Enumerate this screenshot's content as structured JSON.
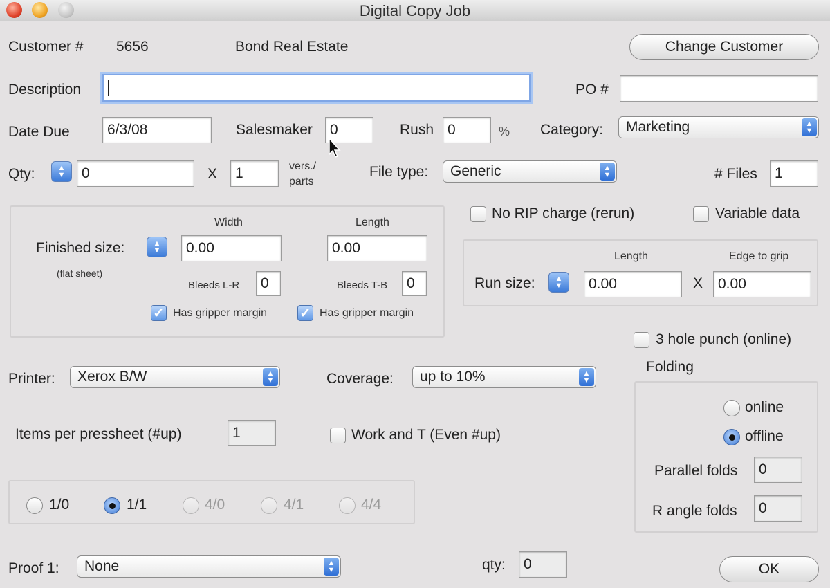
{
  "window": {
    "title": "Digital Copy Job"
  },
  "customer": {
    "label": "Customer #",
    "number": "5656",
    "name": "Bond Real Estate",
    "change_button": "Change Customer"
  },
  "description": {
    "label": "Description",
    "value": ""
  },
  "po": {
    "label": "PO #",
    "value": ""
  },
  "date_due": {
    "label": "Date Due",
    "value": "6/3/08"
  },
  "salesmaker": {
    "label": "Salesmaker",
    "value": "0"
  },
  "rush": {
    "label": "Rush",
    "value": "0",
    "unit": "%"
  },
  "category": {
    "label": "Category:",
    "value": "Marketing"
  },
  "qty": {
    "label": "Qty:",
    "value": "0",
    "x": "X",
    "versions": "1",
    "vers_label_1": "vers./",
    "vers_label_2": "parts"
  },
  "file_type": {
    "label": "File type:",
    "value": "Generic"
  },
  "files": {
    "label": "# Files",
    "value": "1"
  },
  "finished": {
    "label": "Finished size:",
    "sublabel": "(flat sheet)",
    "width_header": "Width",
    "length_header": "Length",
    "width": "0.00",
    "length": "0.00",
    "bleeds_lr_label": "Bleeds L-R",
    "bleeds_lr": "0",
    "bleeds_tb_label": "Bleeds T-B",
    "bleeds_tb": "0",
    "gripper_1": "Has gripper margin",
    "gripper_2": "Has gripper margin"
  },
  "options": {
    "no_rip": "No RIP charge (rerun)",
    "variable_data": "Variable data",
    "hole_punch": "3 hole punch (online)"
  },
  "run_size": {
    "label": "Run size:",
    "length_header": "Length",
    "edge_header": "Edge to grip",
    "length": "0.00",
    "x": "X",
    "edge": "0.00"
  },
  "printer": {
    "label": "Printer:",
    "value": "Xerox B/W"
  },
  "coverage": {
    "label": "Coverage:",
    "value": "up to 10%"
  },
  "items_per": {
    "label": "Items per pressheet (#up)",
    "value": "1"
  },
  "work_and_t": {
    "label": "Work and T (Even #up)"
  },
  "colors": {
    "c10": "1/0",
    "c11": "1/1",
    "c40": "4/0",
    "c41": "4/1",
    "c44": "4/4"
  },
  "folding": {
    "label": "Folding",
    "online": "online",
    "offline": "offline",
    "parallel_label": "Parallel folds",
    "parallel": "0",
    "rangle_label": "R angle folds",
    "rangle": "0"
  },
  "proof": {
    "label": "Proof 1:",
    "value": "None",
    "qty_label": "qty:",
    "qty": "0"
  },
  "ok_button": "OK"
}
